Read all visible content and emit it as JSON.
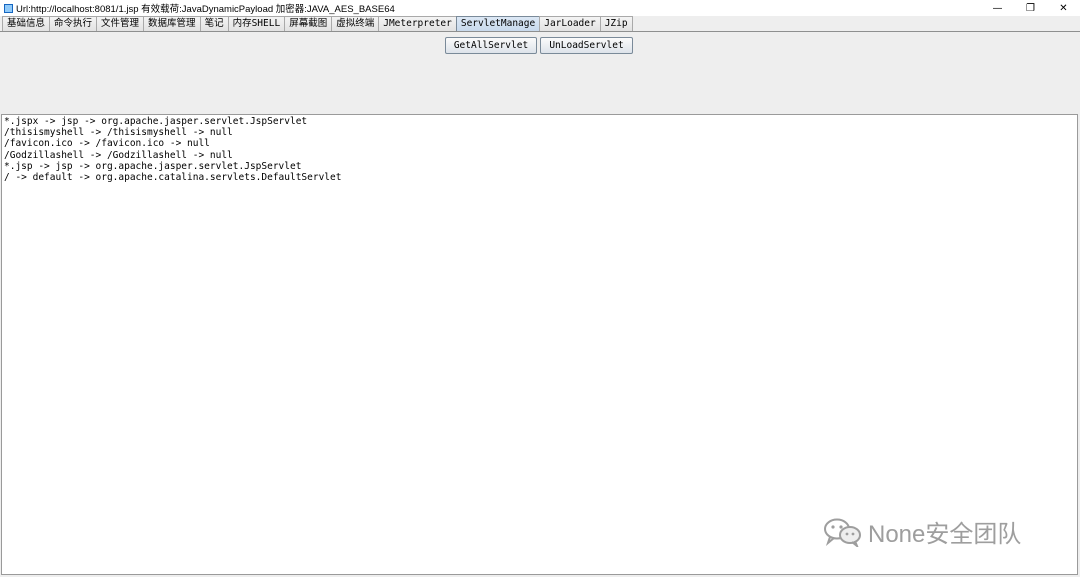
{
  "window": {
    "title": "Url:http://localhost:8081/1.jsp 有效载荷:JavaDynamicPayload 加密器:JAVA_AES_BASE64",
    "controls": {
      "minimize": "—",
      "maximize": "❐",
      "close": "✕"
    }
  },
  "tabs": [
    {
      "label": "基础信息"
    },
    {
      "label": "命令执行"
    },
    {
      "label": "文件管理"
    },
    {
      "label": "数据库管理"
    },
    {
      "label": "笔记"
    },
    {
      "label": "内存SHELL"
    },
    {
      "label": "屏幕截图"
    },
    {
      "label": "虚拟终端"
    },
    {
      "label": "JMeterpreter"
    },
    {
      "label": "ServletManage",
      "active": true
    },
    {
      "label": "JarLoader"
    },
    {
      "label": "JZip"
    }
  ],
  "toolbar": {
    "get_all_servlet": "GetAllServlet",
    "unload_servlet": "UnLoadServlet"
  },
  "output": {
    "lines": [
      "*.jspx -> jsp -> org.apache.jasper.servlet.JspServlet",
      "/thisismyshell -> /thisismyshell -> null",
      "/favicon.ico -> /favicon.ico -> null",
      "/Godzillashell -> /Godzillashell -> null",
      "*.jsp -> jsp -> org.apache.jasper.servlet.JspServlet",
      "/ -> default -> org.apache.catalina.servlets.DefaultServlet"
    ]
  },
  "watermark": {
    "text": "None安全团队",
    "icon": "wechat-icon"
  },
  "colors": {
    "active_tab": "#c8d9ec",
    "panel_bg": "#eeeeee",
    "output_bg": "#ffffff"
  }
}
